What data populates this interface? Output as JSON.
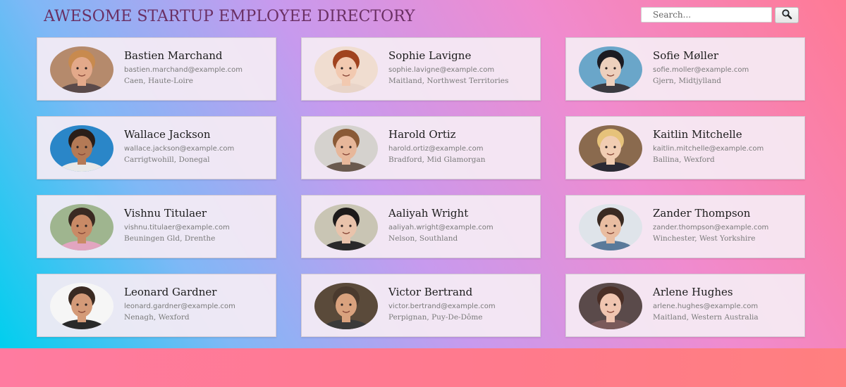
{
  "header": {
    "title": "AWESOME STARTUP EMPLOYEE DIRECTORY"
  },
  "search": {
    "placeholder": "Search...",
    "button_icon": "magnifier-icon"
  },
  "employees": [
    {
      "name": "Bastien Marchand",
      "email": "bastien.marchand@example.com",
      "location": "Caen, Haute-Loire",
      "avatar": {
        "bg": "#b58a6c",
        "skin": "#e3a98a",
        "hair": "#c88a4e",
        "shirt": "#5a4a4a"
      }
    },
    {
      "name": "Sophie Lavigne",
      "email": "sophie.lavigne@example.com",
      "location": "Maitland, Northwest Territories",
      "avatar": {
        "bg": "#f0ddd0",
        "skin": "#f2c9b0",
        "hair": "#a0431f",
        "shirt": "#e8d4c8"
      }
    },
    {
      "name": "Sofie Møller",
      "email": "sofie.moller@example.com",
      "location": "Gjern, Midtjylland",
      "avatar": {
        "bg": "#6aa6c9",
        "skin": "#edd0bd",
        "hair": "#1b1b22",
        "shirt": "#3a3a40"
      }
    },
    {
      "name": "Wallace Jackson",
      "email": "wallace.jackson@example.com",
      "location": "Carrigtwohill, Donegal",
      "avatar": {
        "bg": "#2a86c8",
        "skin": "#b47a56",
        "hair": "#2a1e18",
        "shirt": "#e8e8e8"
      }
    },
    {
      "name": "Harold Ortiz",
      "email": "harold.ortiz@example.com",
      "location": "Bradford, Mid Glamorgan",
      "avatar": {
        "bg": "#d5d2ce",
        "skin": "#e7b79a",
        "hair": "#8a5a36",
        "shirt": "#6a5a4e"
      }
    },
    {
      "name": "Kaitlin Mitchelle",
      "email": "kaitlin.mitchelle@example.com",
      "location": "Ballina, Wexford",
      "avatar": {
        "bg": "#8a6a4e",
        "skin": "#f1cdb2",
        "hair": "#e6c27a",
        "shirt": "#2a2a34"
      }
    },
    {
      "name": "Vishnu Titulaer",
      "email": "vishnu.titulaer@example.com",
      "location": "Beuningen Gld, Drenthe",
      "avatar": {
        "bg": "#9fb58f",
        "skin": "#c98a66",
        "hair": "#3a2a22",
        "shirt": "#e2a5c0"
      }
    },
    {
      "name": "Aaliyah Wright",
      "email": "aaliyah.wright@example.com",
      "location": "Nelson, Southland",
      "avatar": {
        "bg": "#c9c5b4",
        "skin": "#e9c3ab",
        "hair": "#1d1a1a",
        "shirt": "#2a2a2a"
      }
    },
    {
      "name": "Zander Thompson",
      "email": "zander.thompson@example.com",
      "location": "Winchester, West Yorkshire",
      "avatar": {
        "bg": "#dfe4ea",
        "skin": "#e9bda1",
        "hair": "#3a2a22",
        "shirt": "#5a7a9a"
      }
    },
    {
      "name": "Leonard Gardner",
      "email": "leonard.gardner@example.com",
      "location": "Nenagh, Wexford",
      "avatar": {
        "bg": "#f6f6f6",
        "skin": "#d49a78",
        "hair": "#3a2a22",
        "shirt": "#2a2a2a"
      }
    },
    {
      "name": "Victor Bertrand",
      "email": "victor.bertrand@example.com",
      "location": "Perpignan, Puy-De-Dôme",
      "avatar": {
        "bg": "#5a4a3a",
        "skin": "#d9a27e",
        "hair": "#4a3a2e",
        "shirt": "#3a3a3a"
      }
    },
    {
      "name": "Arlene Hughes",
      "email": "arlene.hughes@example.com",
      "location": "Maitland, Western Australia",
      "avatar": {
        "bg": "#5a4a4a",
        "skin": "#f0c5b0",
        "hair": "#4a2e26",
        "shirt": "#7a5a5a"
      }
    }
  ]
}
